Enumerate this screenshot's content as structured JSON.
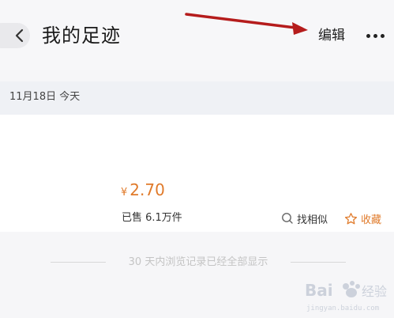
{
  "header": {
    "title": "我的足迹",
    "edit_label": "编辑",
    "back_icon": "chevron-left-icon",
    "more_icon": "more-dots-icon"
  },
  "annotation": {
    "arrow_color": "#b51c1c"
  },
  "history": {
    "date_label": "11月18日 今天",
    "items": [
      {
        "currency": "¥",
        "price": "2.70",
        "sold": "已售 6.1万件",
        "similar_label": "找相似",
        "favorite_label": "收藏"
      }
    ]
  },
  "footer_note": "30 天内浏览记录已经全部显示",
  "watermark": {
    "brand": "Bai 经验",
    "url": "jingyan.baidu.com"
  },
  "colors": {
    "price": "#e07a2a",
    "background": "#f6f6f8",
    "date_bar": "#eff1f5"
  }
}
